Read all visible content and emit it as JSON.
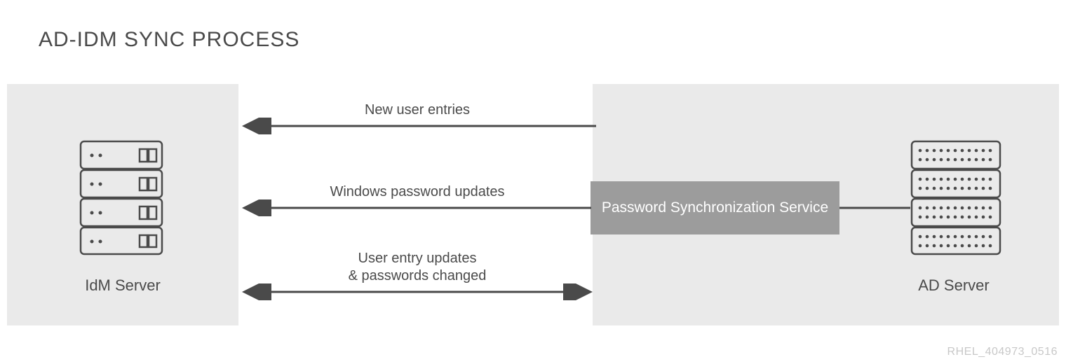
{
  "title": "AD-IDM SYNC PROCESS",
  "left_server_label": "IdM Server",
  "right_server_label": "AD Server",
  "sync_service_label": "Password Synchronization Service",
  "arrows": {
    "new_users": "New user entries",
    "win_pwd": "Windows password updates",
    "bidir": "User entry updates\n& passwords changed"
  },
  "footer": "RHEL_404973_0516",
  "colors": {
    "panel": "#eaeaea",
    "syncbox": "#9c9c9c",
    "stroke": "#4a4a4a"
  }
}
